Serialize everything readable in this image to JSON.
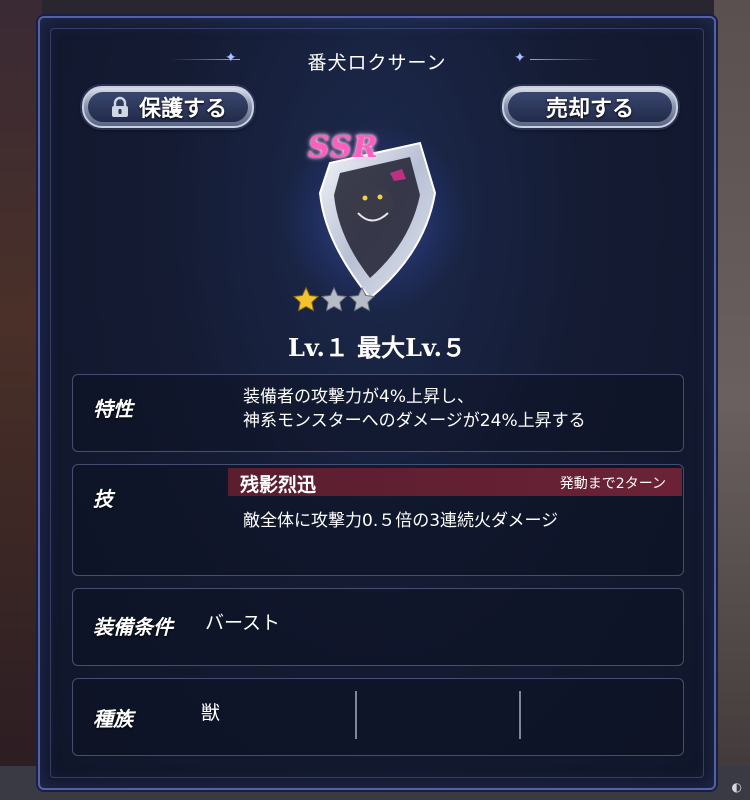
{
  "header": {
    "title": "番犬ロクサーン"
  },
  "buttons": {
    "protect_label": "保護する",
    "sell_label": "売却する"
  },
  "item": {
    "rarity": "SSR",
    "stars_filled": 1,
    "stars_total": 3,
    "level_text": "Lv.１ 最大Lv.５"
  },
  "trait": {
    "label": "特性",
    "line1": "装備者の攻撃力が4%上昇し、",
    "line2": "神系モンスターへのダメージが24%上昇する"
  },
  "skill": {
    "label": "技",
    "name": "残影烈迅",
    "cooldown": "発動まで2ターン",
    "description": "敵全体に攻撃力0.５倍の3連続火ダメージ"
  },
  "equip": {
    "label": "装備条件",
    "value": "バースト"
  },
  "race": {
    "label": "種族",
    "value": "獣"
  },
  "colors": {
    "skill_bar": "#6c2236",
    "rarity": "#ff5ec0",
    "accent": "#5560a8",
    "star_gold": "#f2c230",
    "star_gray": "#b8bcc8"
  },
  "icons": {
    "lock": "lock-icon",
    "star": "star-icon",
    "shield_item": "shield-icon"
  }
}
